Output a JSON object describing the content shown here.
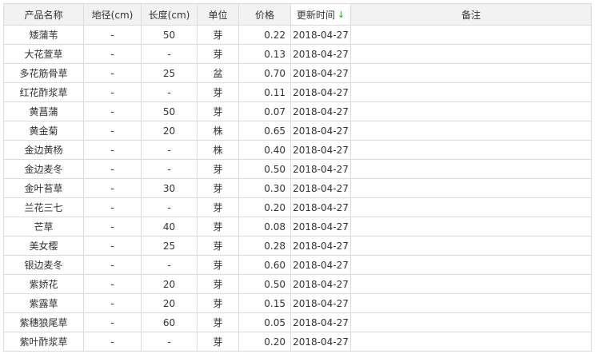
{
  "table": {
    "columns": [
      {
        "key": "name",
        "label": "产品名称"
      },
      {
        "key": "diameter",
        "label": "地径(cm)"
      },
      {
        "key": "length",
        "label": "长度(cm)"
      },
      {
        "key": "unit",
        "label": "单位"
      },
      {
        "key": "price",
        "label": "价格"
      },
      {
        "key": "updated",
        "label": "更新时间"
      },
      {
        "key": "remark",
        "label": "备注"
      }
    ],
    "sort_indicator": "↓",
    "rows": [
      {
        "name": "矮蒲苇",
        "diameter": "-",
        "length": "50",
        "unit": "芽",
        "price": "0.22",
        "updated": "2018-04-27",
        "remark": ""
      },
      {
        "name": "大花萱草",
        "diameter": "-",
        "length": "-",
        "unit": "芽",
        "price": "0.13",
        "updated": "2018-04-27",
        "remark": ""
      },
      {
        "name": "多花筋骨草",
        "diameter": "-",
        "length": "25",
        "unit": "盆",
        "price": "0.70",
        "updated": "2018-04-27",
        "remark": ""
      },
      {
        "name": "红花酢浆草",
        "diameter": "-",
        "length": "-",
        "unit": "芽",
        "price": "0.11",
        "updated": "2018-04-27",
        "remark": ""
      },
      {
        "name": "黄菖蒲",
        "diameter": "-",
        "length": "50",
        "unit": "芽",
        "price": "0.07",
        "updated": "2018-04-27",
        "remark": ""
      },
      {
        "name": "黄金菊",
        "diameter": "-",
        "length": "20",
        "unit": "株",
        "price": "0.65",
        "updated": "2018-04-27",
        "remark": ""
      },
      {
        "name": "金边黄杨",
        "diameter": "-",
        "length": "-",
        "unit": "株",
        "price": "0.40",
        "updated": "2018-04-27",
        "remark": ""
      },
      {
        "name": "金边麦冬",
        "diameter": "-",
        "length": "-",
        "unit": "芽",
        "price": "0.50",
        "updated": "2018-04-27",
        "remark": ""
      },
      {
        "name": "金叶苔草",
        "diameter": "-",
        "length": "30",
        "unit": "芽",
        "price": "0.30",
        "updated": "2018-04-27",
        "remark": ""
      },
      {
        "name": "兰花三七",
        "diameter": "-",
        "length": "-",
        "unit": "芽",
        "price": "0.20",
        "updated": "2018-04-27",
        "remark": ""
      },
      {
        "name": "芒草",
        "diameter": "-",
        "length": "40",
        "unit": "芽",
        "price": "0.08",
        "updated": "2018-04-27",
        "remark": ""
      },
      {
        "name": "美女樱",
        "diameter": "-",
        "length": "25",
        "unit": "芽",
        "price": "0.28",
        "updated": "2018-04-27",
        "remark": ""
      },
      {
        "name": "银边麦冬",
        "diameter": "-",
        "length": "-",
        "unit": "芽",
        "price": "0.60",
        "updated": "2018-04-27",
        "remark": ""
      },
      {
        "name": "紫娇花",
        "diameter": "-",
        "length": "20",
        "unit": "芽",
        "price": "0.50",
        "updated": "2018-04-27",
        "remark": ""
      },
      {
        "name": "紫露草",
        "diameter": "-",
        "length": "20",
        "unit": "芽",
        "price": "0.15",
        "updated": "2018-04-27",
        "remark": ""
      },
      {
        "name": "紫穗狼尾草",
        "diameter": "-",
        "length": "60",
        "unit": "芽",
        "price": "0.05",
        "updated": "2018-04-27",
        "remark": ""
      },
      {
        "name": "紫叶酢浆草",
        "diameter": "-",
        "length": "-",
        "unit": "芽",
        "price": "0.20",
        "updated": "2018-04-27",
        "remark": ""
      }
    ]
  }
}
